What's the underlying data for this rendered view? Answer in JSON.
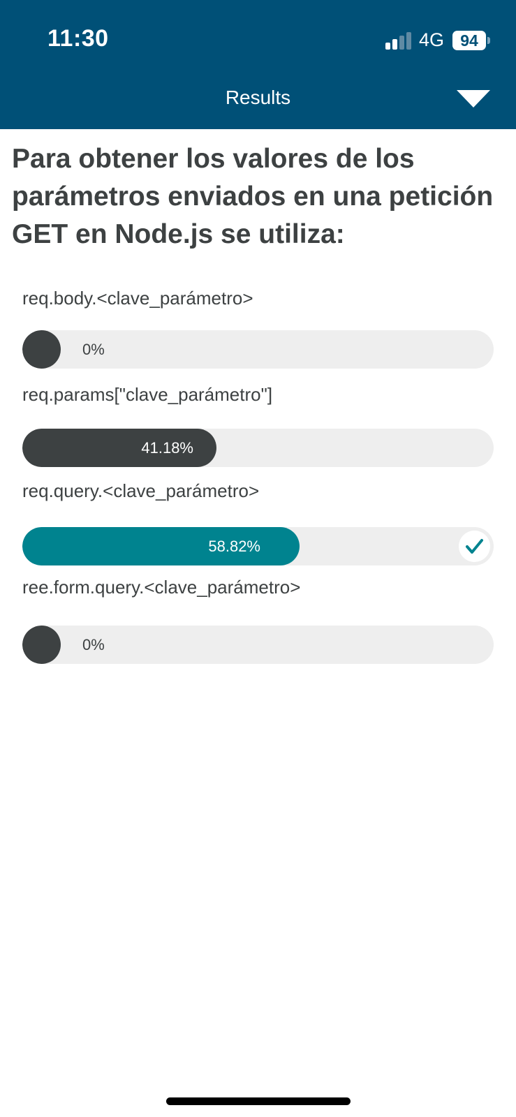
{
  "status_bar": {
    "time": "11:30",
    "network": "4G",
    "battery": "94"
  },
  "header": {
    "title": "Results",
    "collapse_icon": "chevron-down-icon"
  },
  "question": "Para obtener los valores de los parámetros enviados en una petición GET en Node.js se utiliza:",
  "options": [
    {
      "label": "req.body.<clave_parámetro>",
      "percent_text": "0%",
      "percent": 0,
      "correct": false
    },
    {
      "label": "req.params[\"clave_parámetro\"]",
      "percent_text": "41.18%",
      "percent": 41.18,
      "correct": false
    },
    {
      "label": "req.query.<clave_parámetro>",
      "percent_text": "58.82%",
      "percent": 58.82,
      "correct": true
    },
    {
      "label": "ree.form.query.<clave_parámetro>",
      "percent_text": "0%",
      "percent": 0,
      "correct": false
    }
  ],
  "colors": {
    "header_bg": "#005077",
    "bar_default": "#3d4142",
    "bar_correct": "#00838f",
    "track": "#eeeeee"
  }
}
